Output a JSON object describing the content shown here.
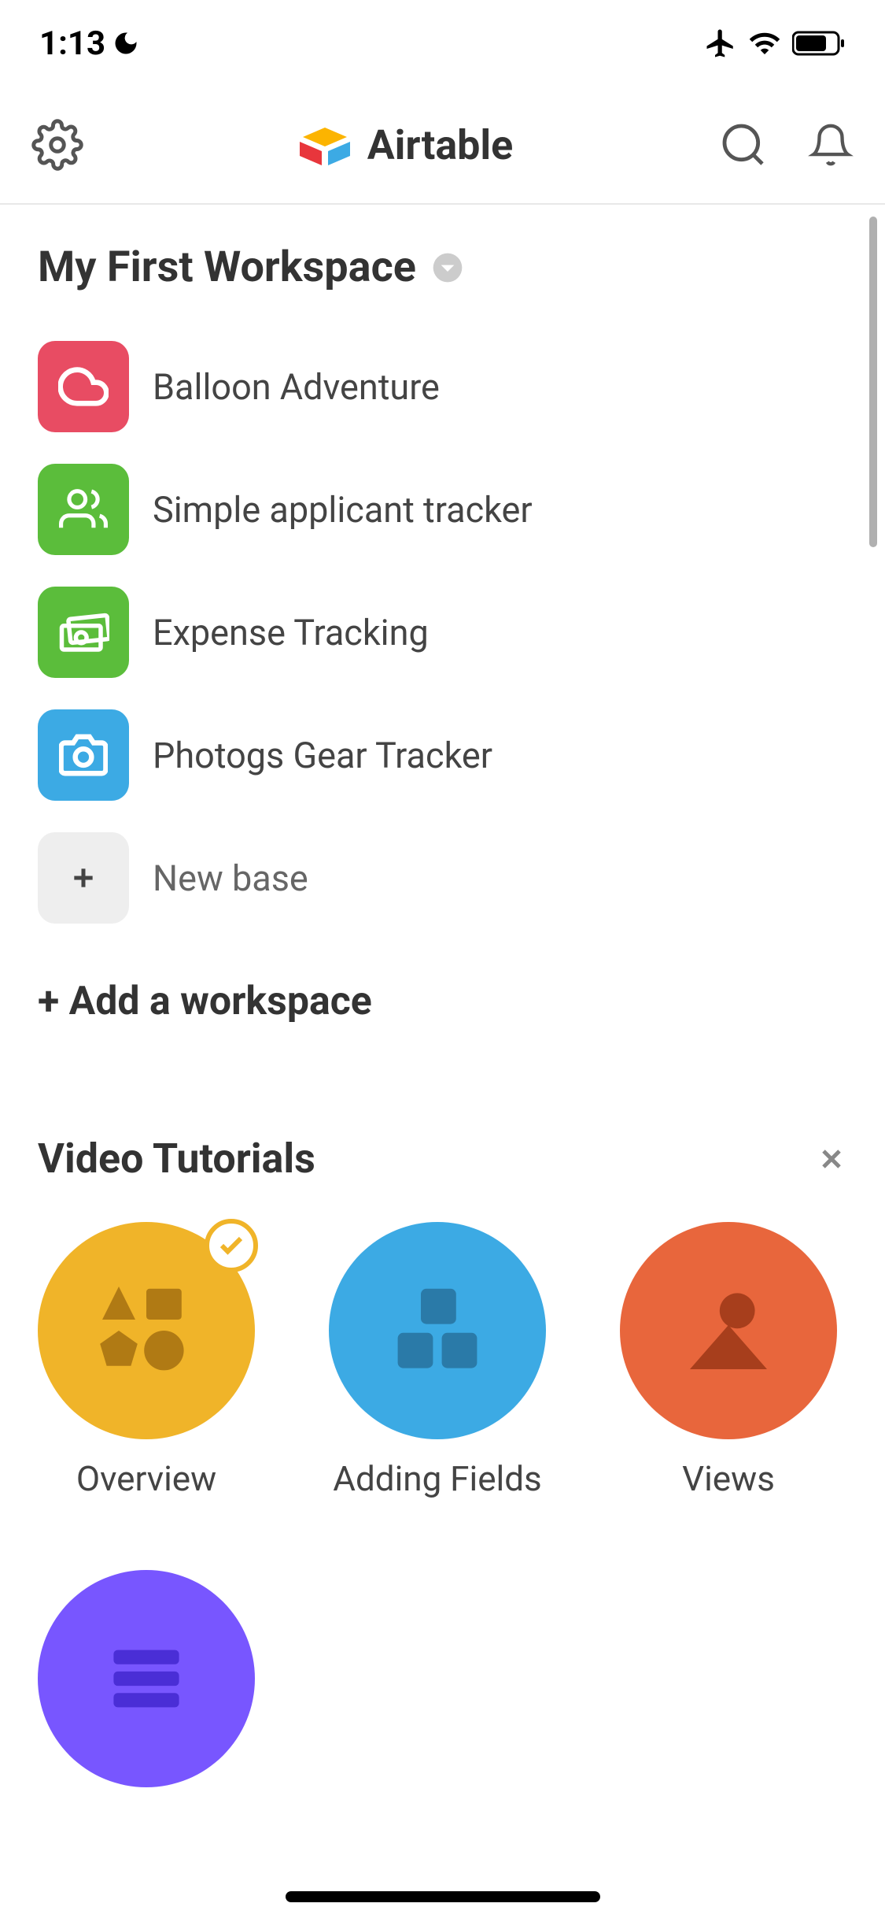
{
  "statusBar": {
    "time": "1:13"
  },
  "header": {
    "appName": "Airtable"
  },
  "workspace": {
    "title": "My First Workspace"
  },
  "bases": [
    {
      "label": "Balloon Adventure",
      "color": "#e84c63",
      "icon": "cloud"
    },
    {
      "label": "Simple applicant tracker",
      "color": "#5bbd3b",
      "icon": "people"
    },
    {
      "label": "Expense Tracking",
      "color": "#5bbd3b",
      "icon": "money"
    },
    {
      "label": "Photogs Gear Tracker",
      "color": "#3caae4",
      "icon": "camera"
    }
  ],
  "newBase": {
    "label": "New base"
  },
  "addWorkspace": {
    "label": "+ Add a workspace"
  },
  "tutorials": {
    "title": "Video Tutorials",
    "items": [
      {
        "label": "Overview",
        "color": "#f0b429",
        "completed": true
      },
      {
        "label": "Adding Fields",
        "color": "#3caae4",
        "completed": false
      },
      {
        "label": "Views",
        "color": "#e8663c",
        "completed": false
      }
    ]
  }
}
